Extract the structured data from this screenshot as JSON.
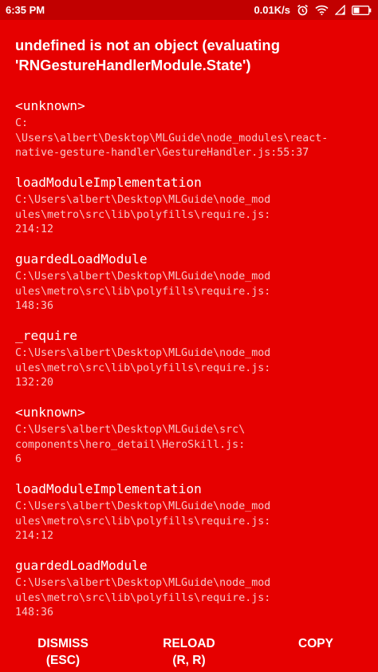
{
  "status_bar": {
    "time": "6:35 PM",
    "net_speed": "0.01K/s",
    "icons": [
      "alarm-icon",
      "wifi-icon",
      "signal-icon",
      "battery-icon"
    ]
  },
  "error": {
    "title": "undefined is not an object (evaluating 'RNGestureHandlerModule.State')"
  },
  "stack": [
    {
      "method": "<unknown>",
      "path": "C:\n\\Users\\albert\\Desktop\\MLGuide\\node_modules\\react-\nnative-gesture-handler\\GestureHandler.js:55:37"
    },
    {
      "method": "loadModuleImplementation",
      "path": "C:\\Users\\albert\\Desktop\\MLGuide\\node_mod\nules\\metro\\src\\lib\\polyfills\\require.js:\n214:12"
    },
    {
      "method": "guardedLoadModule",
      "path": "C:\\Users\\albert\\Desktop\\MLGuide\\node_mod\nules\\metro\\src\\lib\\polyfills\\require.js:\n148:36"
    },
    {
      "method": "_require",
      "path": "C:\\Users\\albert\\Desktop\\MLGuide\\node_mod\nules\\metro\\src\\lib\\polyfills\\require.js:\n132:20"
    },
    {
      "method": "<unknown>",
      "path": "C:\\Users\\albert\\Desktop\\MLGuide\\src\\\ncomponents\\hero_detail\\HeroSkill.js:\n6"
    },
    {
      "method": "loadModuleImplementation",
      "path": "C:\\Users\\albert\\Desktop\\MLGuide\\node_mod\nules\\metro\\src\\lib\\polyfills\\require.js:\n214:12"
    },
    {
      "method": "guardedLoadModule",
      "path": "C:\\Users\\albert\\Desktop\\MLGuide\\node_mod\nules\\metro\\src\\lib\\polyfills\\require.js:\n148:36"
    }
  ],
  "actions": {
    "dismiss": {
      "label": "DISMISS",
      "hint": "(ESC)"
    },
    "reload": {
      "label": "RELOAD",
      "hint": "(R, R)"
    },
    "copy": {
      "label": "COPY"
    }
  },
  "colors": {
    "background": "#e60000",
    "status_bar": "#c10000",
    "text": "#ffffff",
    "path_text": "#f8c6c6"
  }
}
